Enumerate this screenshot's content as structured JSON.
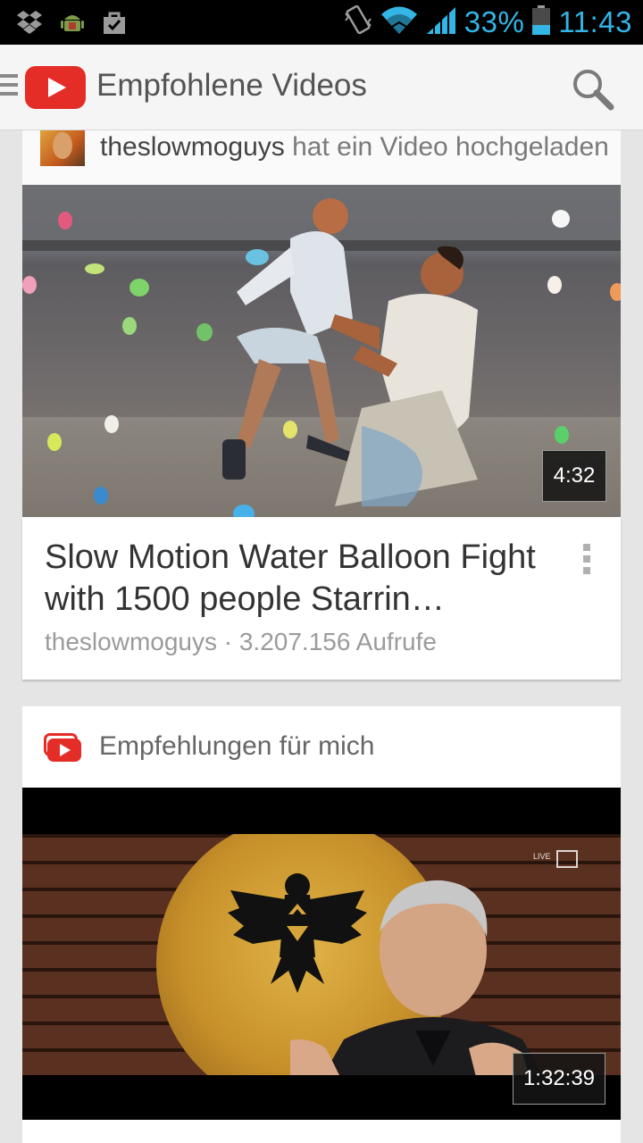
{
  "status_bar": {
    "battery_percent": "33%",
    "time": "11:43",
    "icons": [
      "dropbox-icon",
      "android-debug-icon",
      "shopping-bag-icon",
      "vibrate-icon",
      "wifi-icon",
      "signal-icon",
      "battery-icon"
    ],
    "accent_color": "#33b5e5"
  },
  "action_bar": {
    "title": "Empfohlene Videos",
    "icons": [
      "menu-icon",
      "youtube-logo",
      "search-icon"
    ],
    "brand_color": "#e52d27"
  },
  "feed": {
    "card1": {
      "uploader": "theslowmoguys",
      "action_text": " hat ein Video hochgeladen",
      "duration": "4:32",
      "title": "Slow Motion Water Balloon Fight with 1500 people Starrin…",
      "meta": "theslowmoguys · 3.207.156 Aufrufe"
    },
    "card2": {
      "header": "Empfehlungen für mich",
      "duration": "1:32:39",
      "watermark": "LIVE"
    }
  }
}
